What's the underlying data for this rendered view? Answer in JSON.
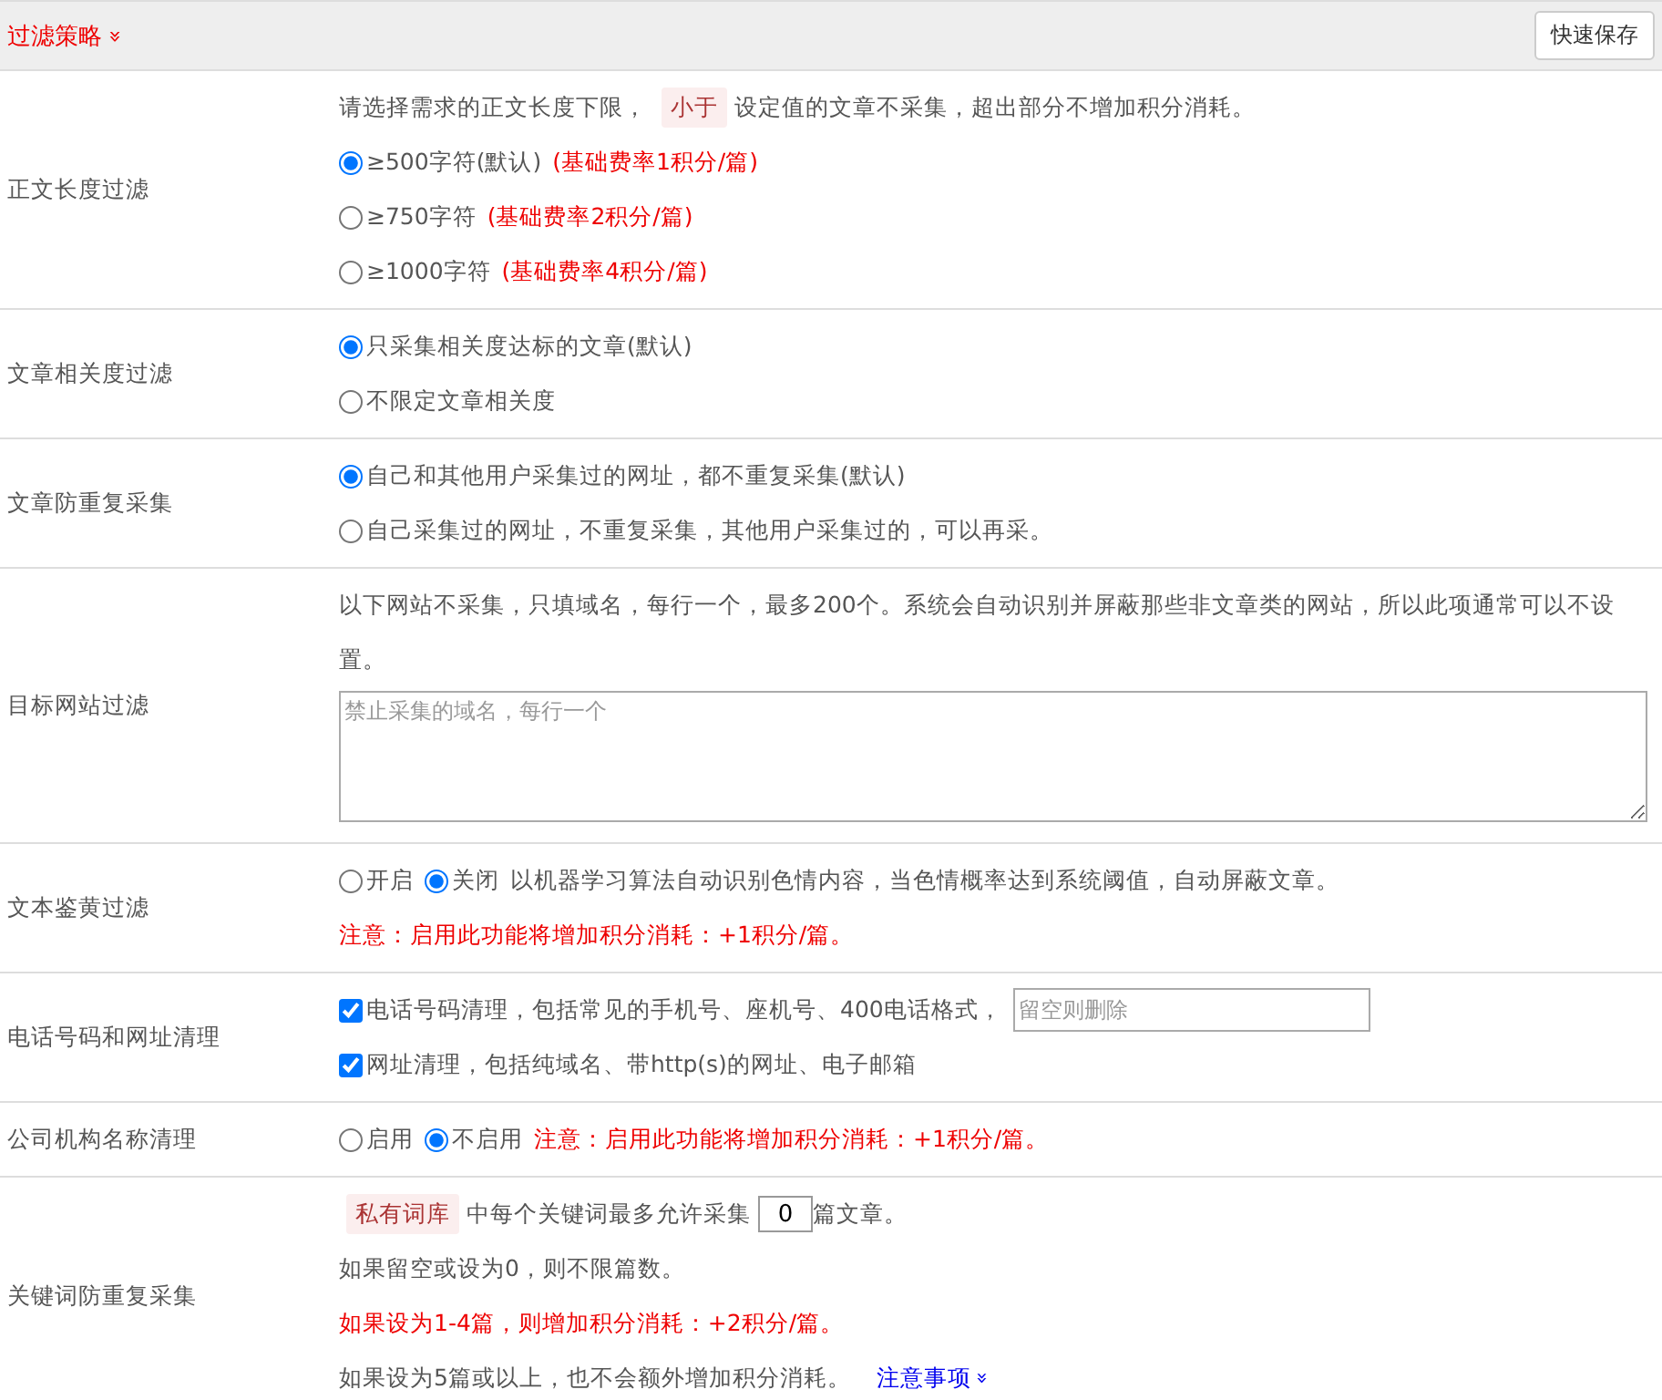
{
  "header": {
    "title": "过滤策略",
    "expand_icon": "»",
    "save_button": "快速保存"
  },
  "sections": [
    {
      "label": "正文长度过滤",
      "lines": [
        [
          {
            "kind": "text",
            "text": "请选择需求的正文长度下限，"
          },
          {
            "kind": "tag",
            "text": "小于"
          },
          {
            "kind": "text",
            "text": "设定值的文章不采集，超出部分不增加积分消耗。"
          }
        ],
        [
          {
            "kind": "radio",
            "text": "≥500字符(默认)",
            "selected": true
          },
          {
            "kind": "note",
            "text": "(基础费率1积分/篇)"
          }
        ],
        [
          {
            "kind": "radio",
            "text": "≥750字符",
            "selected": false
          },
          {
            "kind": "note",
            "text": "(基础费率2积分/篇)"
          }
        ],
        [
          {
            "kind": "radio",
            "text": "≥1000字符",
            "selected": false
          },
          {
            "kind": "note",
            "text": "(基础费率4积分/篇)"
          }
        ]
      ]
    },
    {
      "label": "文章相关度过滤",
      "lines": [
        [
          {
            "kind": "radio",
            "text": "只采集相关度达标的文章(默认)",
            "selected": true
          }
        ],
        [
          {
            "kind": "radio",
            "text": "不限定文章相关度",
            "selected": false
          }
        ]
      ]
    },
    {
      "label": "文章防重复采集",
      "lines": [
        [
          {
            "kind": "radio",
            "text": "自己和其他用户采集过的网址，都不重复采集(默认)",
            "selected": true
          }
        ],
        [
          {
            "kind": "radio",
            "text": "自己采集过的网址，不重复采集，其他用户采集过的，可以再采。",
            "selected": false
          }
        ]
      ]
    },
    {
      "label": "目标网站过滤",
      "lines": [
        [
          {
            "kind": "text",
            "text": "以下网站不采集，只填域名，每行一个，最多200个。系统会自动识别并屏蔽那些非文章类的网站，所以此项通常可以不设置。"
          }
        ],
        [
          {
            "kind": "textarea",
            "placeholder": "禁止采集的域名，每行一个"
          }
        ]
      ]
    },
    {
      "label": "文本鉴黄过滤",
      "lines": [
        [
          {
            "kind": "radio",
            "text": "开启",
            "selected": false
          },
          {
            "kind": "radio",
            "text": "关闭",
            "selected": true
          },
          {
            "kind": "text",
            "text": "以机器学习算法自动识别色情内容，当色情概率达到系统阈值，自动屏蔽文章。"
          }
        ],
        [
          {
            "kind": "note",
            "text": "注意：启用此功能将增加积分消耗：+1积分/篇。"
          }
        ]
      ]
    },
    {
      "label": "电话号码和网址清理",
      "lines": [
        [
          {
            "kind": "checkbox",
            "text": "电话号码清理，包括常见的手机号、座机号、400电话格式，",
            "checked": true
          },
          {
            "kind": "input",
            "placeholder": "留空则删除"
          }
        ],
        [
          {
            "kind": "checkbox",
            "text": "网址清理，包括纯域名、带http(s)的网址、电子邮箱",
            "checked": true
          }
        ]
      ]
    },
    {
      "label": "公司机构名称清理",
      "lines": [
        [
          {
            "kind": "radio",
            "text": "启用",
            "selected": false
          },
          {
            "kind": "radio",
            "text": "不启用",
            "selected": true
          },
          {
            "kind": "note",
            "text": "注意：启用此功能将增加积分消耗：+1积分/篇。"
          }
        ]
      ]
    },
    {
      "label": "关键词防重复采集",
      "lines": [
        [
          {
            "kind": "tag",
            "text": "私有词库"
          },
          {
            "kind": "text",
            "text": "中每个关键词最多允许采集"
          },
          {
            "kind": "number",
            "value": "0"
          },
          {
            "kind": "text",
            "text": "篇文章。"
          }
        ],
        [
          {
            "kind": "text",
            "text": "如果留空或设为0，则不限篇数。"
          }
        ],
        [
          {
            "kind": "note",
            "text": "如果设为1-4篇，则增加积分消耗：+2积分/篇。"
          }
        ],
        [
          {
            "kind": "text",
            "text": "如果设为5篇或以上，也不会额外增加积分消耗。"
          },
          {
            "kind": "link",
            "text": "注意事项",
            "icon": "»"
          }
        ]
      ]
    }
  ]
}
